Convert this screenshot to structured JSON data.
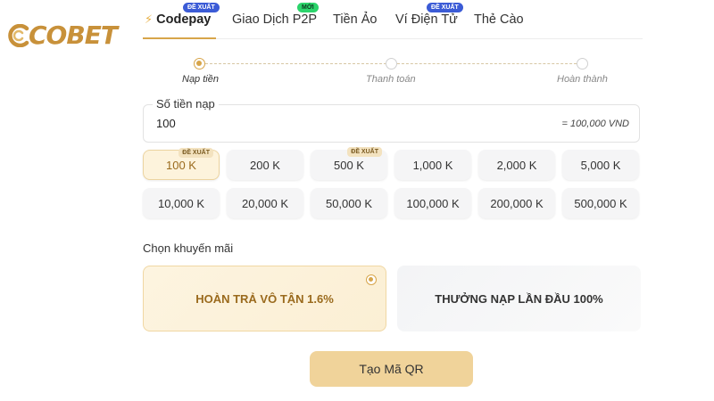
{
  "brand": {
    "logo_text": "COBET"
  },
  "tabs": [
    {
      "label": "Codepay",
      "badge": "ĐỀ XUẤT",
      "active": true
    },
    {
      "label": "Giao Dịch P2P",
      "badge": "MỚI"
    },
    {
      "label": "Tiền Ảo",
      "badge": ""
    },
    {
      "label": "Ví Điện Tử",
      "badge": "ĐỀ XUẤT"
    },
    {
      "label": "Thẻ Cào",
      "badge": ""
    }
  ],
  "steps": [
    {
      "label": "Nạp tiền",
      "active": true
    },
    {
      "label": "Thanh toán",
      "active": false
    },
    {
      "label": "Hoàn thành",
      "active": false
    }
  ],
  "amount": {
    "legend": "Số tiền nạp",
    "value": "100",
    "converted": "= 100,000 VND"
  },
  "quick_amounts": [
    {
      "label": "100 K",
      "badge": "ĐỀ XUẤT",
      "selected": true
    },
    {
      "label": "200 K"
    },
    {
      "label": "500 K",
      "badge": "ĐỀ XUẤT"
    },
    {
      "label": "1,000 K"
    },
    {
      "label": "2,000 K"
    },
    {
      "label": "5,000 K"
    },
    {
      "label": "10,000 K"
    },
    {
      "label": "20,000 K"
    },
    {
      "label": "50,000 K"
    },
    {
      "label": "100,000 K"
    },
    {
      "label": "200,000 K"
    },
    {
      "label": "500,000 K"
    }
  ],
  "promotion": {
    "label": "Chọn khuyến mãi",
    "options": [
      {
        "label": "HOÀN TRẢ VÔ TẬN 1.6%",
        "selected": true
      },
      {
        "label": "THƯỞNG NẠP LẦN ĐẦU 100%",
        "selected": false
      }
    ]
  },
  "submit_label": "Tạo Mã QR",
  "colors": {
    "accent": "#d7a54a",
    "button": "#f0d39a",
    "selected_bg": "#fdf3dc",
    "badge_blue": "#3b5bd6",
    "badge_green": "#2bd46b"
  },
  "icons": {
    "active_tab": "lightning-bolt-icon",
    "logo": "cobet-logo-icon"
  }
}
